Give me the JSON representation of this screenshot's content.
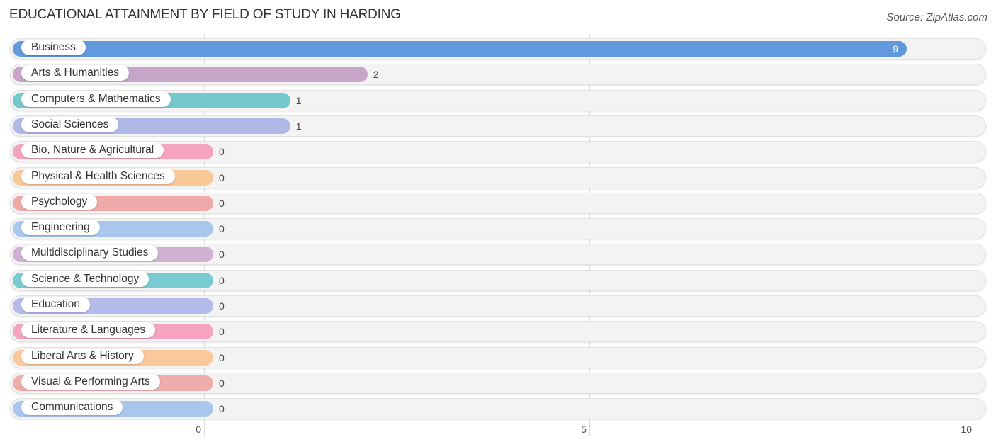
{
  "header": {
    "title": "EDUCATIONAL ATTAINMENT BY FIELD OF STUDY IN HARDING",
    "source": "Source: ZipAtlas.com"
  },
  "chart_data": {
    "type": "bar",
    "orientation": "horizontal",
    "title": "EDUCATIONAL ATTAINMENT BY FIELD OF STUDY IN HARDING",
    "xlabel": "",
    "ylabel": "",
    "xlim": [
      0,
      10
    ],
    "xticks": [
      0,
      5,
      10
    ],
    "xtick_labels": [
      "0",
      "5",
      "10"
    ],
    "grid": true,
    "categories": [
      "Business",
      "Arts & Humanities",
      "Computers & Mathematics",
      "Social Sciences",
      "Bio, Nature & Agricultural",
      "Physical & Health Sciences",
      "Psychology",
      "Engineering",
      "Multidisciplinary Studies",
      "Science & Technology",
      "Education",
      "Literature & Languages",
      "Liberal Arts & History",
      "Visual & Performing Arts",
      "Communications"
    ],
    "values": [
      9,
      2,
      1,
      1,
      0,
      0,
      0,
      0,
      0,
      0,
      0,
      0,
      0,
      0,
      0
    ],
    "value_labels": [
      "9",
      "2",
      "1",
      "1",
      "0",
      "0",
      "0",
      "0",
      "0",
      "0",
      "0",
      "0",
      "0",
      "0",
      "0"
    ],
    "colors": [
      "#6199dc",
      "#c6a5c9",
      "#73c8cb",
      "#b0b8e8",
      "#f5a3be",
      "#f9c897",
      "#eeaaa9",
      "#a9c6ec",
      "#d1b1d3",
      "#79cbd2",
      "#b4bbea",
      "#f5a3c0",
      "#f9c99c",
      "#eeadab",
      "#a9c6ec"
    ]
  }
}
